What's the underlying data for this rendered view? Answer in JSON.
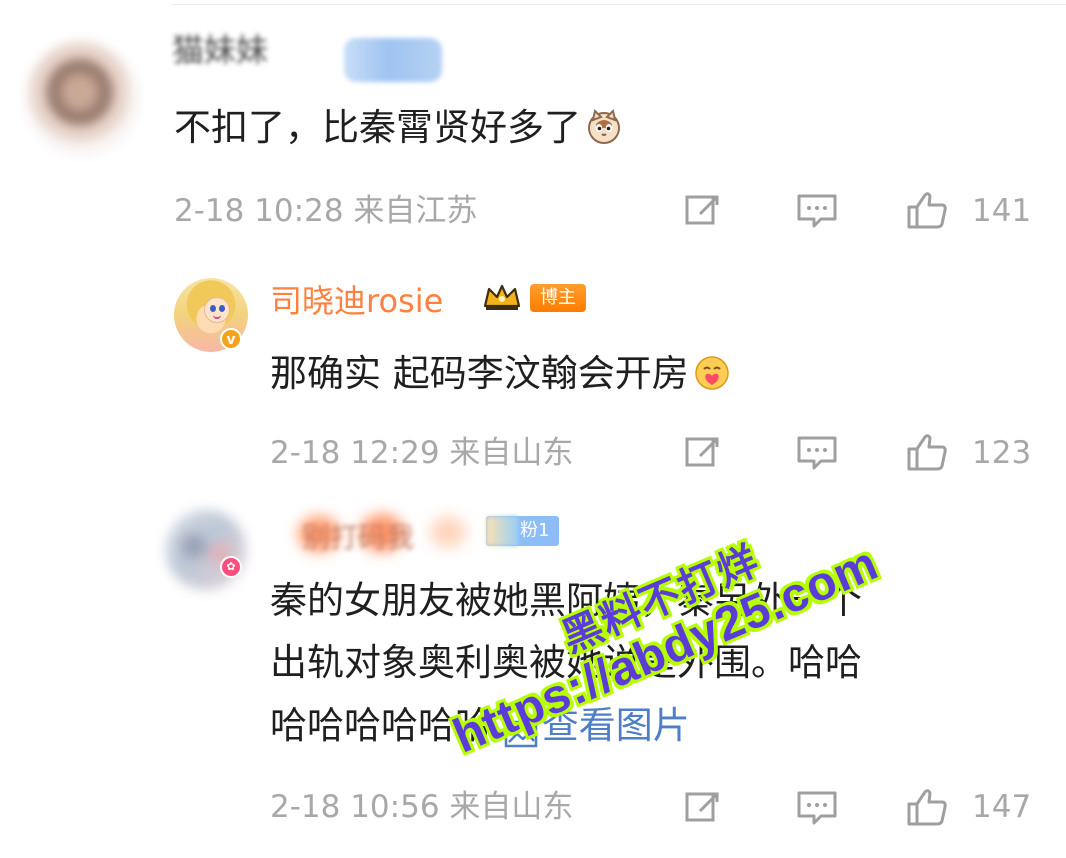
{
  "comments": [
    {
      "author": "猫妹妹",
      "text": "不扣了，比秦霄贤好多了",
      "meta": "2-18 10:28 来自江苏",
      "likes": "141"
    }
  ],
  "replies": [
    {
      "author": "司晓迪rosie",
      "badge": "博主",
      "text": "那确实 起码李汶翰会开房",
      "meta": "2-18 12:29 来自山东",
      "likes": "123"
    },
    {
      "author": "别打码我",
      "fan_badge": "粉1",
      "text_line1": "秦的女朋友被她黑阿姨，秦另外一个",
      "text_line2": "出轨对象奥利奥被她说是外围。哈哈",
      "text_line3": "哈哈哈哈哈哈",
      "image_link": "查看图片",
      "meta": "2-18 10:56 来自山东",
      "likes": "147"
    }
  ],
  "watermark": {
    "line1": "黑料不打烊",
    "line2": "https://abdy25.com"
  }
}
